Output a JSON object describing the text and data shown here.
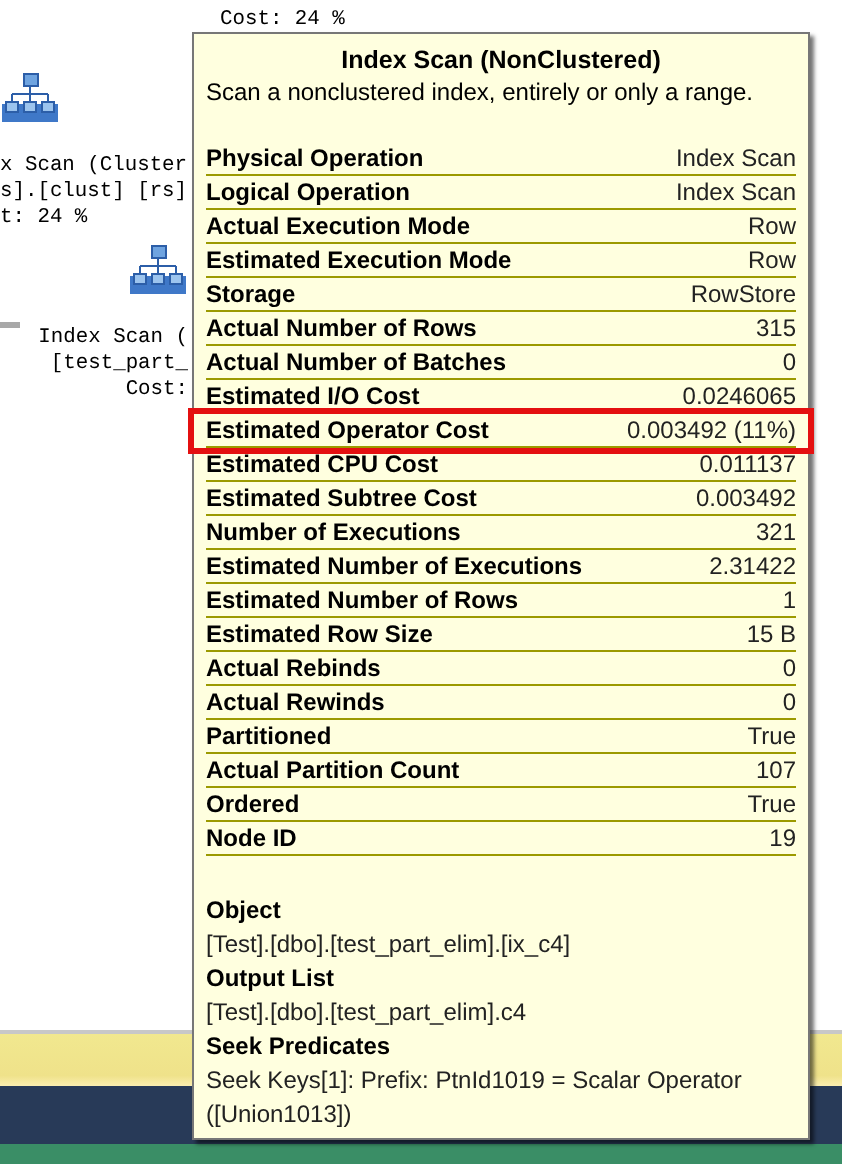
{
  "plan_nodes": [
    {
      "kind": "text_only",
      "lines": [
        "Cost: 24 %"
      ]
    },
    {
      "kind": "left",
      "lines": [
        "x Scan (Cluster",
        "s].[clust] [rs]",
        "t: 24 %"
      ]
    },
    {
      "kind": "center",
      "lines": [
        "Index Scan (",
        "[test_part_",
        "Cost:"
      ]
    }
  ],
  "tooltip": {
    "title": "Index Scan (NonClustered)",
    "description": "Scan a nonclustered index, entirely or only a range.",
    "properties": [
      {
        "name": "Physical Operation",
        "value": "Index Scan",
        "highlighted": false
      },
      {
        "name": "Logical Operation",
        "value": "Index Scan",
        "highlighted": false
      },
      {
        "name": "Actual Execution Mode",
        "value": "Row",
        "highlighted": false
      },
      {
        "name": "Estimated Execution Mode",
        "value": "Row",
        "highlighted": false
      },
      {
        "name": "Storage",
        "value": "RowStore",
        "highlighted": false
      },
      {
        "name": "Actual Number of Rows",
        "value": "315",
        "highlighted": false
      },
      {
        "name": "Actual Number of Batches",
        "value": "0",
        "highlighted": false
      },
      {
        "name": "Estimated I/O Cost",
        "value": "0.0246065",
        "highlighted": false
      },
      {
        "name": "Estimated Operator Cost",
        "value": "0.003492 (11%)",
        "highlighted": true
      },
      {
        "name": "Estimated CPU Cost",
        "value": "0.011137",
        "highlighted": false
      },
      {
        "name": "Estimated Subtree Cost",
        "value": "0.003492",
        "highlighted": false
      },
      {
        "name": "Number of Executions",
        "value": "321",
        "highlighted": false
      },
      {
        "name": "Estimated Number of Executions",
        "value": "2.31422",
        "highlighted": false
      },
      {
        "name": "Estimated Number of Rows",
        "value": "1",
        "highlighted": false
      },
      {
        "name": "Estimated Row Size",
        "value": "15 B",
        "highlighted": false
      },
      {
        "name": "Actual Rebinds",
        "value": "0",
        "highlighted": false
      },
      {
        "name": "Actual Rewinds",
        "value": "0",
        "highlighted": false
      },
      {
        "name": "Partitioned",
        "value": "True",
        "highlighted": false
      },
      {
        "name": "Actual Partition Count",
        "value": "107",
        "highlighted": false
      },
      {
        "name": "Ordered",
        "value": "True",
        "highlighted": false
      },
      {
        "name": "Node ID",
        "value": "19",
        "highlighted": false
      }
    ],
    "sections": [
      {
        "heading": "Object",
        "text": "[Test].[dbo].[test_part_elim].[ix_c4]"
      },
      {
        "heading": "Output List",
        "text": "[Test].[dbo].[test_part_elim].c4"
      },
      {
        "heading": "Seek Predicates",
        "text": "Seek Keys[1]: Prefix: PtnId1019 = Scalar Operator ([Union1013])"
      }
    ]
  }
}
